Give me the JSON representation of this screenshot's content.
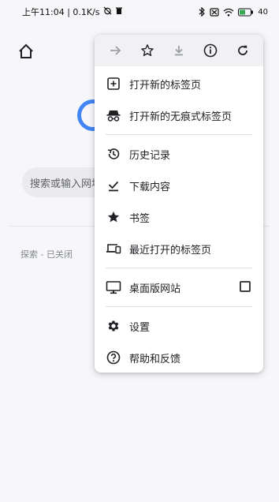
{
  "status_bar": {
    "time_text": "上午11:04 | 0.1K/s",
    "battery_text": "40"
  },
  "page": {
    "search_placeholder": "搜索或输入网址",
    "explore_text": "探索 - 已关闭"
  },
  "menu": {
    "toolbar": {
      "forward_icon": "forward-arrow-icon",
      "bookmark_icon": "star-outline-icon",
      "download_icon": "download-icon",
      "info_icon": "info-icon",
      "refresh_icon": "refresh-icon"
    },
    "items": [
      {
        "label": "打开新的标签页",
        "icon": "new-tab-icon"
      },
      {
        "label": "打开新的无痕式标签页",
        "icon": "incognito-icon"
      },
      {
        "label": "历史记录",
        "icon": "history-icon"
      },
      {
        "label": "下载内容",
        "icon": "download-done-icon"
      },
      {
        "label": "书签",
        "icon": "star-icon"
      },
      {
        "label": "最近打开的标签页",
        "icon": "devices-icon"
      },
      {
        "label": "桌面版网站",
        "icon": "desktop-icon",
        "checked": false
      },
      {
        "label": "设置",
        "icon": "gear-icon"
      },
      {
        "label": "帮助和反馈",
        "icon": "help-icon"
      }
    ]
  }
}
